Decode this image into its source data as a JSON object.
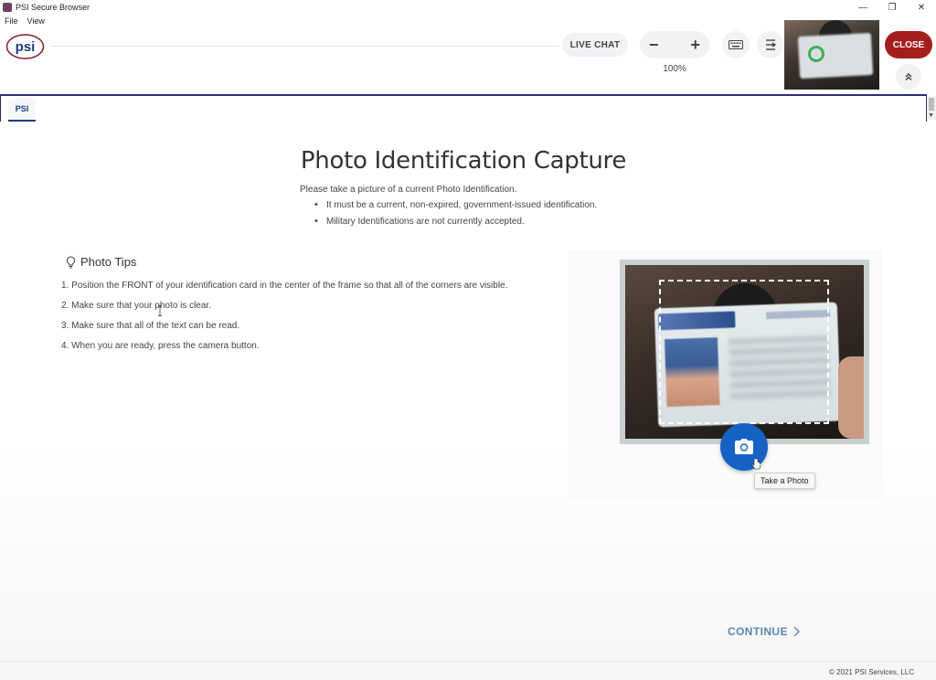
{
  "window": {
    "title": "PSI Secure Browser",
    "minimize": "—",
    "restore": "❐",
    "close": "✕"
  },
  "menu": [
    "File",
    "View"
  ],
  "toolbar": {
    "logo_text": "psi",
    "live_chat": "LIVE CHAT",
    "zoom_out": "−",
    "zoom_in": "+",
    "zoom_level": "100%",
    "close_label": "CLOSE"
  },
  "tabs": [
    {
      "label": "PSI"
    }
  ],
  "page": {
    "title": "Photo Identification Capture",
    "intro": "Please take a picture of a current Photo Identification.",
    "requirements": [
      "It must be a current, non-expired, government-issued identification.",
      "Military Identifications are not currently accepted."
    ],
    "tips_heading": "Photo Tips",
    "tips": [
      "1. Position the FRONT of your identification card in the center of the frame so that all of the corners are visible.",
      "2. Make sure that your photo is clear.",
      "3. Make sure that all of the text can be read.",
      "4. When you are ready, press the camera button."
    ],
    "camera_tooltip": "Take a Photo",
    "continue_label": "CONTINUE"
  },
  "footer": {
    "copyright": "© 2021 PSI Services, LLC"
  },
  "colors": {
    "close": "#a51d1d",
    "camera": "#1662c4",
    "continue": "#5a86b4",
    "tab_border": "#2c2c7a"
  },
  "icons": [
    "lightbulb-icon",
    "camera-icon",
    "keyboard-icon",
    "fit-width-icon",
    "chevron-up-double-icon",
    "chevron-right-icon"
  ]
}
